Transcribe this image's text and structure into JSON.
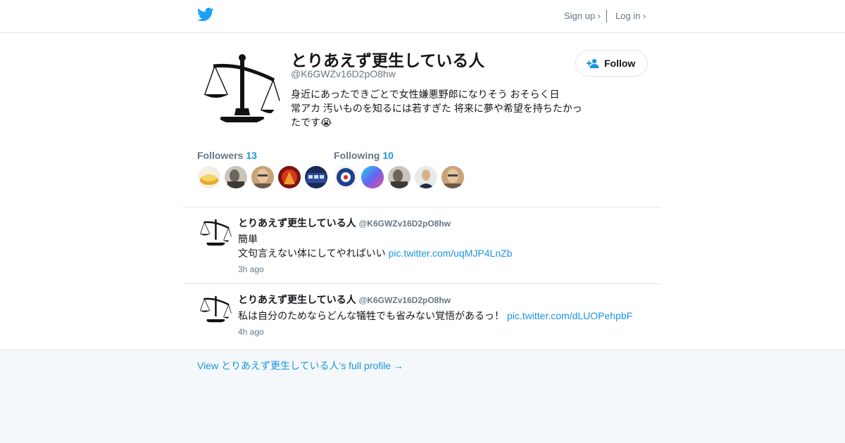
{
  "header": {
    "logo_icon": "twitter-bird-icon",
    "signup_label": "Sign up ›",
    "login_label": "Log in ›"
  },
  "profile": {
    "name": "とりあえず更生している人",
    "handle": "@K6GWZv16D2pO8hw",
    "bio_line1": "身近にあったできごとで女性嫌悪野郎になりそう おそらく日",
    "bio_line2": "常アカ 汚いものを知るには若すぎた 将来に夢や希望を持ちたかっ",
    "bio_line3": "たです😭",
    "avatar_icon": "balance-scale-icon",
    "follow_label": "Follow"
  },
  "stats": {
    "followers_label": "Followers",
    "followers_count": "13",
    "following_label": "Following",
    "following_count": "10"
  },
  "tweets": [
    {
      "name": "とりあえず更生している人",
      "handle": "@K6GWZv16D2pO8hw",
      "line1": "簡単",
      "line2": "文句言えない体にしてやればいい",
      "link": "pic.twitter.com/uqMJP4LnZb",
      "time": "3h ago"
    },
    {
      "name": "とりあえず更生している人",
      "handle": "@K6GWZv16D2pO8hw",
      "line1": "私は自分のためならどんな犠牲でも省みない覚悟があるっ！",
      "link": "pic.twitter.com/dLUOPehpbF",
      "time": "4h ago"
    }
  ],
  "footer": {
    "full_profile_label": "View とりあえず更生している人's full profile →"
  },
  "colors": {
    "accent": "#1b95e0",
    "muted": "#657786",
    "logo": "#1da1f2"
  }
}
